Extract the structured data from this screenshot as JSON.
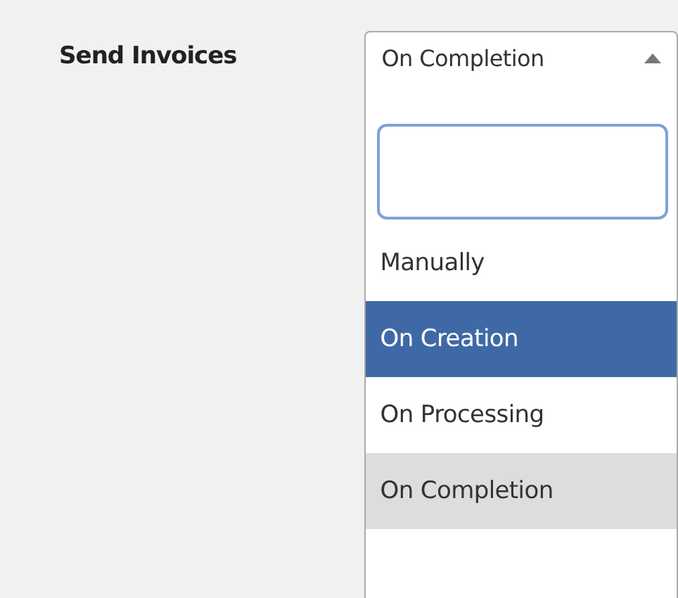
{
  "field": {
    "label": "Send Invoices",
    "value": "On Completion",
    "expanded": true
  },
  "options": [
    {
      "label": "Manually",
      "selected": false,
      "hovered": false
    },
    {
      "label": "On Creation",
      "selected": false,
      "hovered": true
    },
    {
      "label": "On Processing",
      "selected": false,
      "hovered": false
    },
    {
      "label": "On Completion",
      "selected": true,
      "hovered": false
    }
  ]
}
